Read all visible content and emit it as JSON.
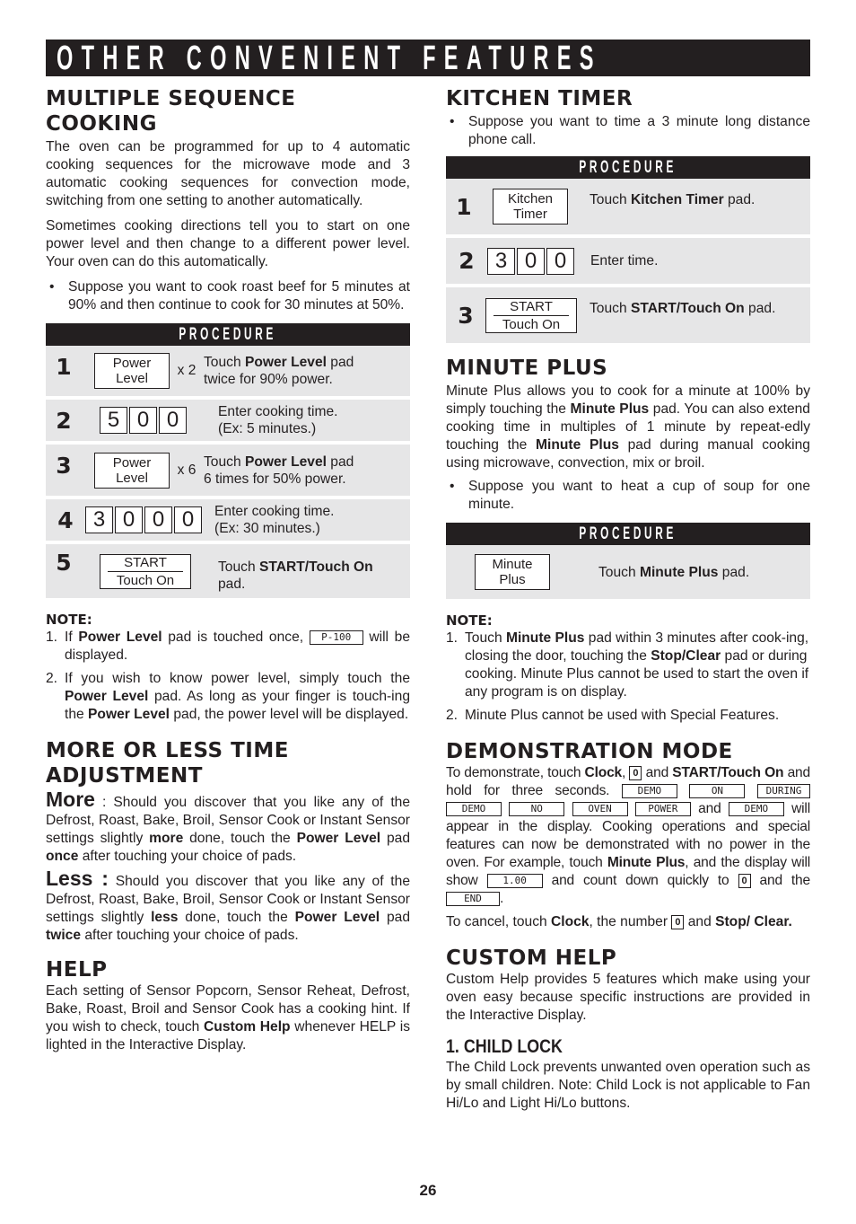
{
  "banner": {
    "title": "OTHER CONVENIENT FEATURES"
  },
  "multiple_sequence": {
    "heading": "MULTIPLE SEQUENCE COOKING",
    "p1": "The oven can be programmed for up to 4 automatic cooking sequences for the microwave mode and 3 automatic cooking sequences for convection mode, switching from one setting to another automatically.",
    "p2": "Sometimes cooking directions tell you to start on one power level and then change to a different power level. Your oven can do this automatically.",
    "bullet": "Suppose you want to cook roast beef for 5 minutes at 90% and then continue to cook for 30 minutes at 50%.",
    "procedure_label": "PROCEDURE",
    "steps": [
      {
        "num": "1",
        "pad_top": "Power",
        "pad_bottom": "Level",
        "mult": "x 2",
        "text_a": "Touch ",
        "text_b": "Power Level",
        "text_c": " pad twice for 90% power."
      },
      {
        "num": "2",
        "digits": [
          "5",
          "0",
          "0"
        ],
        "line1": "Enter cooking time.",
        "line2": "(Ex: 5 minutes.)"
      },
      {
        "num": "3",
        "pad_top": "Power",
        "pad_bottom": "Level",
        "mult": "x 6",
        "text_a": "Touch ",
        "text_b": "Power Level",
        "text_c": " pad 6 times for 50% power."
      },
      {
        "num": "4",
        "digits": [
          "3",
          "0",
          "0",
          "0"
        ],
        "line1": "Enter cooking time.",
        "line2": "(Ex: 30 minutes.)"
      },
      {
        "num": "5",
        "pad_top": "START",
        "pad_bottom": "Touch On",
        "text_a": "Touch ",
        "text_b": "START/Touch On",
        "text_c": " pad."
      }
    ],
    "note_label": "NOTE:",
    "notes": [
      {
        "n": "1.",
        "a": "If ",
        "b": "Power Level",
        "c": " pad is touched once, ",
        "lcd": "P-100",
        "d": " will be displayed."
      },
      {
        "n": "2.",
        "a": "If you wish to know power level, simply touch the ",
        "b": "Power Level",
        "c": " pad. As long as your finger is touch-ing the ",
        "d": "Power Level",
        "e": " pad, the power level will be displayed."
      }
    ]
  },
  "more_less": {
    "heading": "MORE OR LESS TIME ADJUSTMENT",
    "more": {
      "lead": "More",
      "a": " : Should you discover that you like any of the Defrost, Roast, Bake, Broil, Sensor Cook or Instant Sensor settings slightly ",
      "b": "more",
      "c": " done, touch the ",
      "d": "Power Level",
      "e": " pad ",
      "f": "once",
      "g": " after touching your choice of pads."
    },
    "less": {
      "lead": "Less :",
      "a": " Should you discover that you like any of the Defrost, Roast, Bake, Broil, Sensor Cook or Instant Sensor settings slightly ",
      "b": "less",
      "c": " done, touch the ",
      "d": "Power Level",
      "e": " pad ",
      "f": "twice",
      "g": " after touching your choice of pads."
    }
  },
  "help": {
    "heading": "HELP",
    "a": "Each setting of Sensor Popcorn, Sensor Reheat, Defrost, Bake, Roast, Broil and Sensor Cook has a cooking hint. If you wish to check, touch ",
    "b": "Custom Help",
    "c": " whenever HELP is lighted in the Interactive Display."
  },
  "kitchen_timer": {
    "heading": "KITCHEN TIMER",
    "bullet": "Suppose you want to time a 3 minute long distance phone call.",
    "procedure_label": "PROCEDURE",
    "steps": [
      {
        "num": "1",
        "pad_top": "Kitchen",
        "pad_bottom": "Timer",
        "text_a": "Touch ",
        "text_b": "Kitchen Timer",
        "text_c": " pad."
      },
      {
        "num": "2",
        "digits": [
          "3",
          "0",
          "0"
        ],
        "text": "Enter time."
      },
      {
        "num": "3",
        "pad_top": "START",
        "pad_bottom": "Touch On",
        "text_a": "Touch ",
        "text_b": "START/Touch On",
        "text_c": " pad."
      }
    ]
  },
  "minute_plus": {
    "heading": "MINUTE PLUS",
    "p_a": "Minute Plus allows you to cook for a minute at 100% by simply touching the ",
    "p_b": "Minute Plus",
    "p_c": " pad. You can also extend cooking time in multiples of 1 minute by repeat-edly touching the ",
    "p_d": "Minute Plus",
    "p_e": " pad during manual cooking using microwave, convection, mix or broil.",
    "bullet": "Suppose you want to heat a cup of soup for one minute.",
    "procedure_label": "PROCEDURE",
    "step": {
      "pad_top": "Minute",
      "pad_bottom": "Plus",
      "text_a": "Touch ",
      "text_b": "Minute Plus",
      "text_c": " pad."
    },
    "note_label": "NOTE:",
    "notes": [
      {
        "n": "1.",
        "a": "Touch ",
        "b": "Minute Plus",
        "c": " pad within 3 minutes after cook-ing, closing the door, touching the ",
        "d": "Stop/Clear",
        "e": " pad or during cooking. Minute Plus cannot be used to start the oven if any program is on display."
      },
      {
        "n": "2.",
        "a": "Minute Plus cannot be used with Special Features."
      }
    ]
  },
  "demo_mode": {
    "heading": "DEMONSTRATION MODE",
    "a": "To demonstrate, touch ",
    "b": "Clock",
    "c": ", ",
    "zero": "0",
    "d": " and ",
    "e": "START/Touch On",
    "f": " and hold for three seconds. ",
    "displays": [
      "DEMO",
      "ON",
      "DURING",
      "DEMO",
      "NO",
      "OVEN",
      "POWER"
    ],
    "and": " and ",
    "display_last": "DEMO",
    "g": " will appear in the display. Cooking operations and special features can now be demonstrated with no power in the oven. For example, touch ",
    "h": "Minute Plus",
    "i": ", and the display will show ",
    "lcd_time": "1.00",
    "j": " and count down quickly to ",
    "k": " and the ",
    "lcd_end": "END",
    "l": ".",
    "cancel_a": "To cancel, touch ",
    "cancel_b": "Clock",
    "cancel_c": ", the number ",
    "cancel_d": " and ",
    "cancel_e": "Stop/ Clear."
  },
  "custom_help": {
    "heading": "CUSTOM HELP",
    "p": "Custom Help provides 5 features which make using your oven easy because specific instructions are provided in the Interactive Display.",
    "sub_heading": "1. CHILD LOCK",
    "sub_p": "The Child Lock prevents unwanted oven operation such as by small children. Note: Child Lock is not applicable to Fan Hi/Lo and Light Hi/Lo buttons."
  },
  "page_number": "26"
}
